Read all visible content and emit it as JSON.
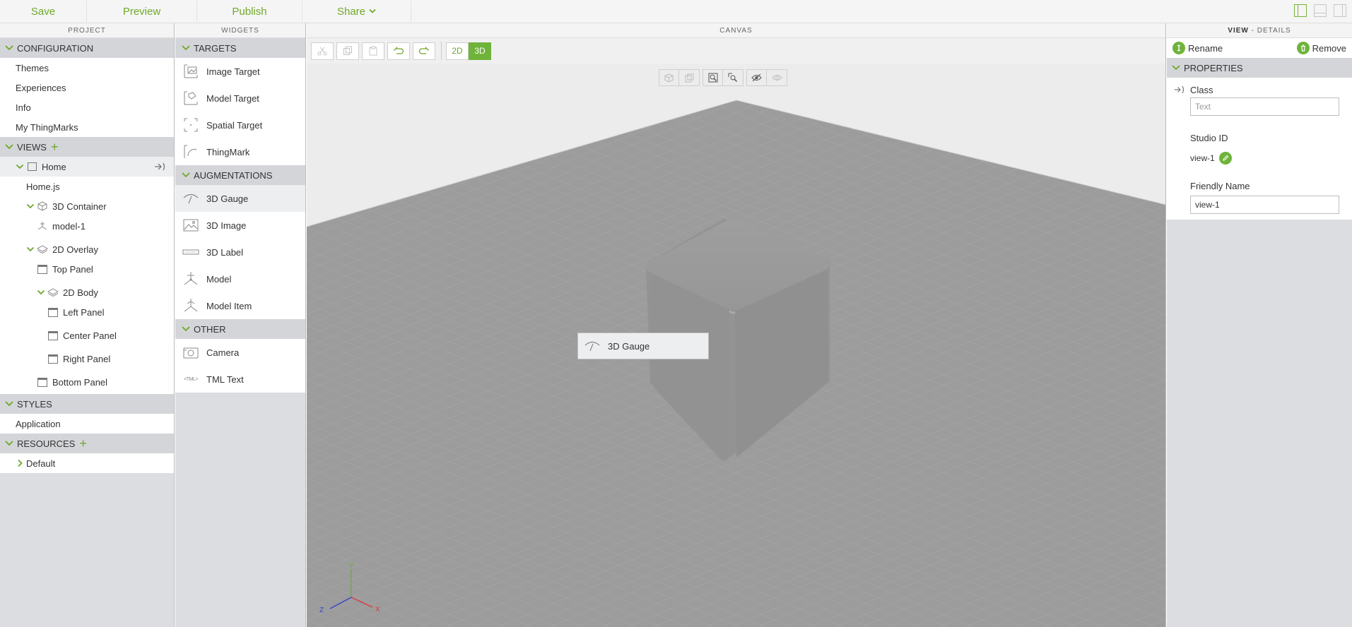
{
  "toolbar": {
    "save": "Save",
    "preview": "Preview",
    "publish": "Publish",
    "share": "Share"
  },
  "panels": {
    "project": "PROJECT",
    "widgets": "WIDGETS",
    "canvas": "CANVAS",
    "details_strong": "VIEW",
    "details_rest": " - DETAILS"
  },
  "project": {
    "configuration": "CONFIGURATION",
    "config_items": [
      "Themes",
      "Experiences",
      "Info",
      "My ThingMarks"
    ],
    "views": "VIEWS",
    "home": "Home",
    "home_js": "Home.js",
    "container_3d": "3D Container",
    "model_1": "model-1",
    "overlay_2d": "2D Overlay",
    "top_panel": "Top Panel",
    "body_2d": "2D Body",
    "left_panel": "Left Panel",
    "center_panel": "Center Panel",
    "right_panel": "Right Panel",
    "bottom_panel": "Bottom Panel",
    "styles": "STYLES",
    "application": "Application",
    "resources": "RESOURCES",
    "default": "Default"
  },
  "widgets": {
    "targets": "TARGETS",
    "target_items": [
      "Image Target",
      "Model Target",
      "Spatial Target",
      "ThingMark"
    ],
    "augmentations": "AUGMENTATIONS",
    "augmentation_items": [
      "3D Gauge",
      "3D Image",
      "3D Label",
      "Model",
      "Model Item"
    ],
    "other": "OTHER",
    "other_items": [
      "Camera",
      "TML Text"
    ],
    "tml_icon_text": "<TML>"
  },
  "canvas": {
    "mode_2d": "2D",
    "mode_3d": "3D",
    "drag_label": "3D Gauge",
    "axis_x": "X",
    "axis_y": "Y",
    "axis_z": "Z"
  },
  "details": {
    "rename": "Rename",
    "remove": "Remove",
    "properties": "PROPERTIES",
    "class_label": "Class",
    "class_placeholder": "Text",
    "studio_id_label": "Studio ID",
    "studio_id_value": "view-1",
    "friendly_name_label": "Friendly Name",
    "friendly_name_value": "view-1"
  },
  "colors": {
    "accent": "#6fb33b",
    "accent_text": "#6fa82a",
    "section_bg": "#d4d5d9",
    "canvas_bg": "#9a9a9a"
  }
}
